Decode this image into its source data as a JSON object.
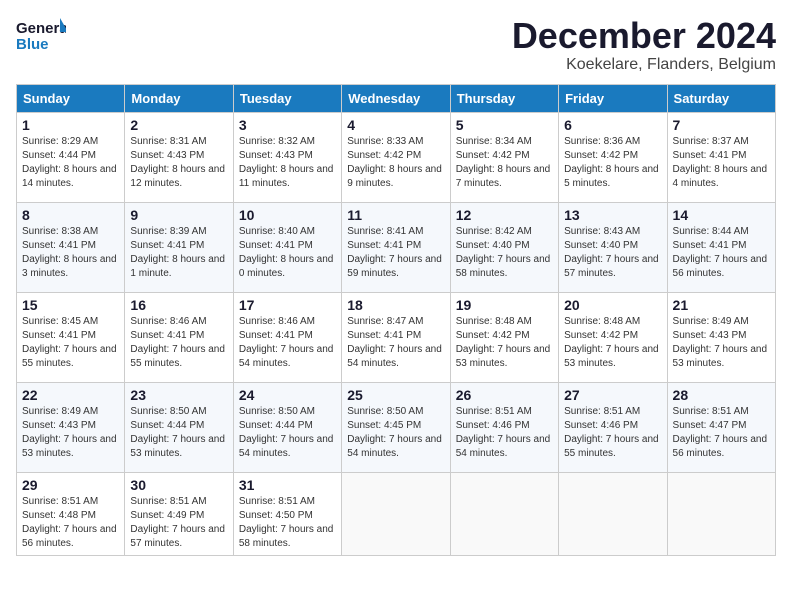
{
  "header": {
    "logo_line1": "General",
    "logo_line2": "Blue",
    "month_year": "December 2024",
    "location": "Koekelare, Flanders, Belgium"
  },
  "weekdays": [
    "Sunday",
    "Monday",
    "Tuesday",
    "Wednesday",
    "Thursday",
    "Friday",
    "Saturday"
  ],
  "weeks": [
    [
      {
        "day": "1",
        "sunrise": "8:29 AM",
        "sunset": "4:44 PM",
        "daylight": "8 hours and 14 minutes."
      },
      {
        "day": "2",
        "sunrise": "8:31 AM",
        "sunset": "4:43 PM",
        "daylight": "8 hours and 12 minutes."
      },
      {
        "day": "3",
        "sunrise": "8:32 AM",
        "sunset": "4:43 PM",
        "daylight": "8 hours and 11 minutes."
      },
      {
        "day": "4",
        "sunrise": "8:33 AM",
        "sunset": "4:42 PM",
        "daylight": "8 hours and 9 minutes."
      },
      {
        "day": "5",
        "sunrise": "8:34 AM",
        "sunset": "4:42 PM",
        "daylight": "8 hours and 7 minutes."
      },
      {
        "day": "6",
        "sunrise": "8:36 AM",
        "sunset": "4:42 PM",
        "daylight": "8 hours and 5 minutes."
      },
      {
        "day": "7",
        "sunrise": "8:37 AM",
        "sunset": "4:41 PM",
        "daylight": "8 hours and 4 minutes."
      }
    ],
    [
      {
        "day": "8",
        "sunrise": "8:38 AM",
        "sunset": "4:41 PM",
        "daylight": "8 hours and 3 minutes."
      },
      {
        "day": "9",
        "sunrise": "8:39 AM",
        "sunset": "4:41 PM",
        "daylight": "8 hours and 1 minute."
      },
      {
        "day": "10",
        "sunrise": "8:40 AM",
        "sunset": "4:41 PM",
        "daylight": "8 hours and 0 minutes."
      },
      {
        "day": "11",
        "sunrise": "8:41 AM",
        "sunset": "4:41 PM",
        "daylight": "7 hours and 59 minutes."
      },
      {
        "day": "12",
        "sunrise": "8:42 AM",
        "sunset": "4:40 PM",
        "daylight": "7 hours and 58 minutes."
      },
      {
        "day": "13",
        "sunrise": "8:43 AM",
        "sunset": "4:40 PM",
        "daylight": "7 hours and 57 minutes."
      },
      {
        "day": "14",
        "sunrise": "8:44 AM",
        "sunset": "4:41 PM",
        "daylight": "7 hours and 56 minutes."
      }
    ],
    [
      {
        "day": "15",
        "sunrise": "8:45 AM",
        "sunset": "4:41 PM",
        "daylight": "7 hours and 55 minutes."
      },
      {
        "day": "16",
        "sunrise": "8:46 AM",
        "sunset": "4:41 PM",
        "daylight": "7 hours and 55 minutes."
      },
      {
        "day": "17",
        "sunrise": "8:46 AM",
        "sunset": "4:41 PM",
        "daylight": "7 hours and 54 minutes."
      },
      {
        "day": "18",
        "sunrise": "8:47 AM",
        "sunset": "4:41 PM",
        "daylight": "7 hours and 54 minutes."
      },
      {
        "day": "19",
        "sunrise": "8:48 AM",
        "sunset": "4:42 PM",
        "daylight": "7 hours and 53 minutes."
      },
      {
        "day": "20",
        "sunrise": "8:48 AM",
        "sunset": "4:42 PM",
        "daylight": "7 hours and 53 minutes."
      },
      {
        "day": "21",
        "sunrise": "8:49 AM",
        "sunset": "4:43 PM",
        "daylight": "7 hours and 53 minutes."
      }
    ],
    [
      {
        "day": "22",
        "sunrise": "8:49 AM",
        "sunset": "4:43 PM",
        "daylight": "7 hours and 53 minutes."
      },
      {
        "day": "23",
        "sunrise": "8:50 AM",
        "sunset": "4:44 PM",
        "daylight": "7 hours and 53 minutes."
      },
      {
        "day": "24",
        "sunrise": "8:50 AM",
        "sunset": "4:44 PM",
        "daylight": "7 hours and 54 minutes."
      },
      {
        "day": "25",
        "sunrise": "8:50 AM",
        "sunset": "4:45 PM",
        "daylight": "7 hours and 54 minutes."
      },
      {
        "day": "26",
        "sunrise": "8:51 AM",
        "sunset": "4:46 PM",
        "daylight": "7 hours and 54 minutes."
      },
      {
        "day": "27",
        "sunrise": "8:51 AM",
        "sunset": "4:46 PM",
        "daylight": "7 hours and 55 minutes."
      },
      {
        "day": "28",
        "sunrise": "8:51 AM",
        "sunset": "4:47 PM",
        "daylight": "7 hours and 56 minutes."
      }
    ],
    [
      {
        "day": "29",
        "sunrise": "8:51 AM",
        "sunset": "4:48 PM",
        "daylight": "7 hours and 56 minutes."
      },
      {
        "day": "30",
        "sunrise": "8:51 AM",
        "sunset": "4:49 PM",
        "daylight": "7 hours and 57 minutes."
      },
      {
        "day": "31",
        "sunrise": "8:51 AM",
        "sunset": "4:50 PM",
        "daylight": "7 hours and 58 minutes."
      },
      null,
      null,
      null,
      null
    ]
  ],
  "labels": {
    "sunrise_prefix": "Sunrise: ",
    "sunset_prefix": "Sunset: ",
    "daylight_prefix": "Daylight: "
  }
}
